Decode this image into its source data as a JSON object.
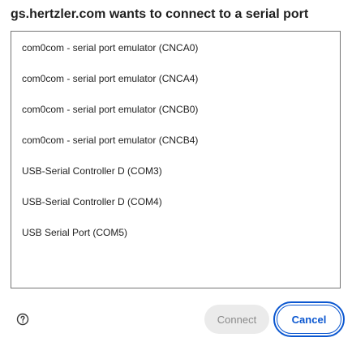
{
  "dialog": {
    "title": "gs.hertzler.com wants to connect to a serial port"
  },
  "ports": [
    {
      "label": "com0com - serial port emulator (CNCA0)"
    },
    {
      "label": "com0com - serial port emulator (CNCA4)"
    },
    {
      "label": "com0com - serial port emulator (CNCB0)"
    },
    {
      "label": "com0com - serial port emulator (CNCB4)"
    },
    {
      "label": "USB-Serial Controller D (COM3)"
    },
    {
      "label": "USB-Serial Controller D (COM4)"
    },
    {
      "label": "USB Serial Port (COM5)"
    }
  ],
  "footer": {
    "help_icon": "help-circle-icon",
    "connect_label": "Connect",
    "connect_state": "disabled",
    "cancel_label": "Cancel",
    "cancel_state": "focused"
  },
  "colors": {
    "accent": "#0b57d0",
    "disabled_bg": "#ebebeb",
    "disabled_text": "#8a8a8a",
    "list_border": "#757575"
  }
}
